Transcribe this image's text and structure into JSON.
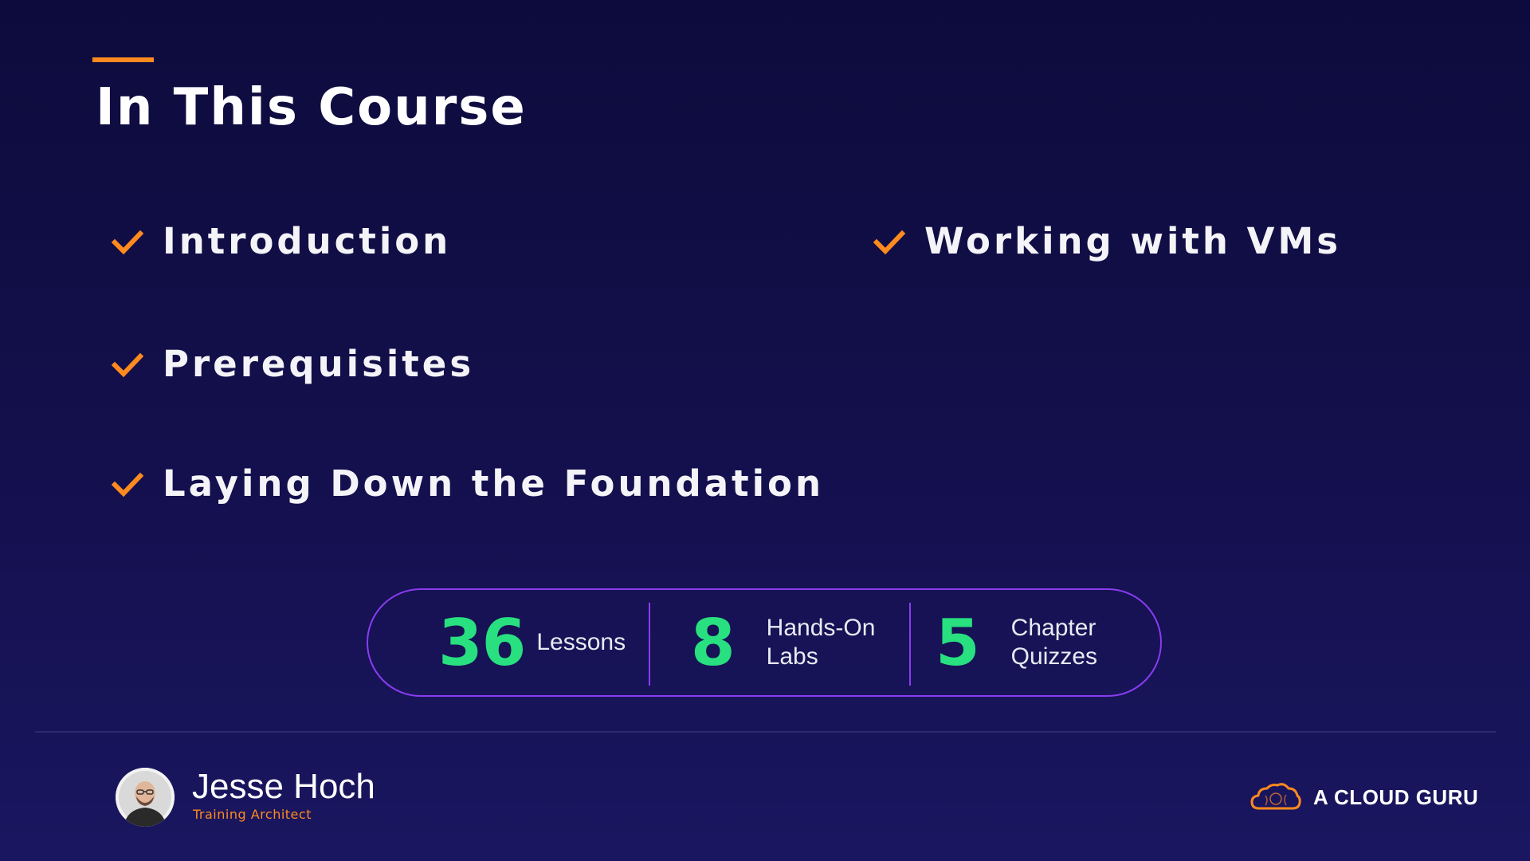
{
  "slide": {
    "title": "In This Course",
    "topics": [
      {
        "label": "Introduction"
      },
      {
        "label": "Prerequisites"
      },
      {
        "label": "Laying Down the Foundation"
      },
      {
        "label": "Working with VMs"
      }
    ],
    "stats": [
      {
        "value": "36",
        "label_line1": "Lessons",
        "label_line2": ""
      },
      {
        "value": "8",
        "label_line1": "Hands-On",
        "label_line2": "Labs"
      },
      {
        "value": "5",
        "label_line1": "Chapter",
        "label_line2": "Quizzes"
      }
    ]
  },
  "presenter": {
    "name": "Jesse Hoch",
    "role": "Training Architect"
  },
  "brand": {
    "name": "A CLOUD GURU"
  },
  "colors": {
    "accent": "#ff8a1f",
    "stat_number": "#28e07f",
    "pill_border": "#8a3cf0",
    "background": "#130f4a"
  },
  "icons": {
    "topic_marker": "checkmark-icon",
    "brand_logo": "cloud-logo-icon"
  }
}
